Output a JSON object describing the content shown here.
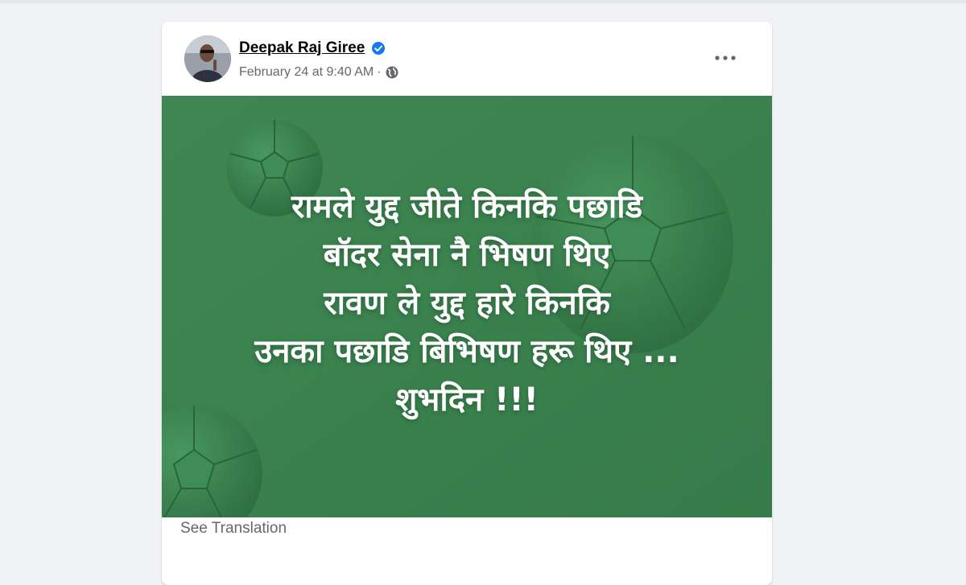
{
  "post": {
    "author": "Deepak Raj Giree",
    "timestamp": "February 24 at 9:40 AM",
    "separator": "·",
    "privacy_icon": "globe-icon",
    "verified_icon": "verified-badge-icon",
    "more_icon": "more-options-icon",
    "image_text_lines": [
      "रामले युद्द जीते किनकि पछाडि",
      "बॉदर सेना नै भिषण थिए",
      "रावण ले युद्द हारे किनकि",
      "उनका पछाडि बिभिषण हरू थिए ...",
      "शुभदिन !!!"
    ],
    "see_translation": "See Translation"
  },
  "colors": {
    "image_background": "#3d8251",
    "verified_blue": "#1877f2",
    "page_background": "#f0f2f5"
  }
}
